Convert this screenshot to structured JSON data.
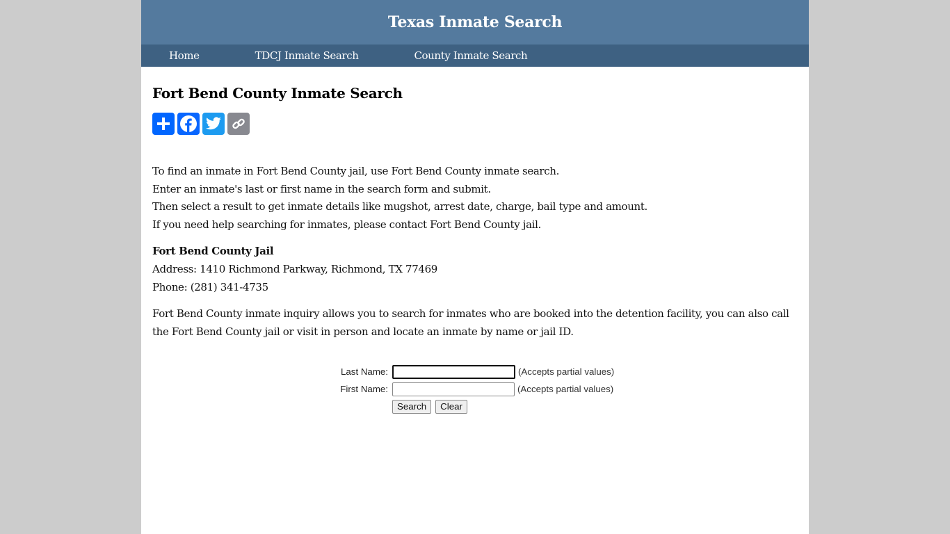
{
  "header": {
    "title": "Texas Inmate Search"
  },
  "nav": {
    "items": [
      "Home",
      "TDCJ Inmate Search",
      "County Inmate Search"
    ]
  },
  "page": {
    "title": "Fort Bend County Inmate Search",
    "share": [
      {
        "icon": "share-plus-icon",
        "label": "Share",
        "color": "#0166ff"
      },
      {
        "icon": "facebook-icon",
        "label": "Facebook",
        "color": "#0866ff"
      },
      {
        "icon": "twitter-icon",
        "label": "Twitter",
        "color": "#1d9bf0"
      },
      {
        "icon": "copy-link-icon",
        "label": "Copy Link",
        "color": "#888990"
      }
    ],
    "intro": [
      "To find an inmate in Fort Bend County jail, use Fort Bend County inmate search.",
      "Enter an inmate's last or first name in the search form and submit.",
      "Then select a result to get inmate details like mugshot, arrest date, charge, bail type and amount.",
      "If you need help searching for inmates, please contact Fort Bend County jail."
    ],
    "jail": {
      "name": "Fort Bend County Jail",
      "address": "Address: 1410 Richmond Parkway, Richmond, TX 77469",
      "phone": "Phone: (281) 341-4735"
    },
    "inquiry": "Fort Bend County inmate inquiry allows you to search for inmates who are booked into the detention facility, you can also call the Fort Bend County jail or visit in person and locate an inmate by name or jail ID."
  },
  "form": {
    "last_name_label": "Last Name:",
    "last_name_value": "",
    "first_name_label": "First Name:",
    "first_name_value": "",
    "hint": "(Accepts partial values)",
    "search_label": "Search",
    "clear_label": "Clear"
  }
}
